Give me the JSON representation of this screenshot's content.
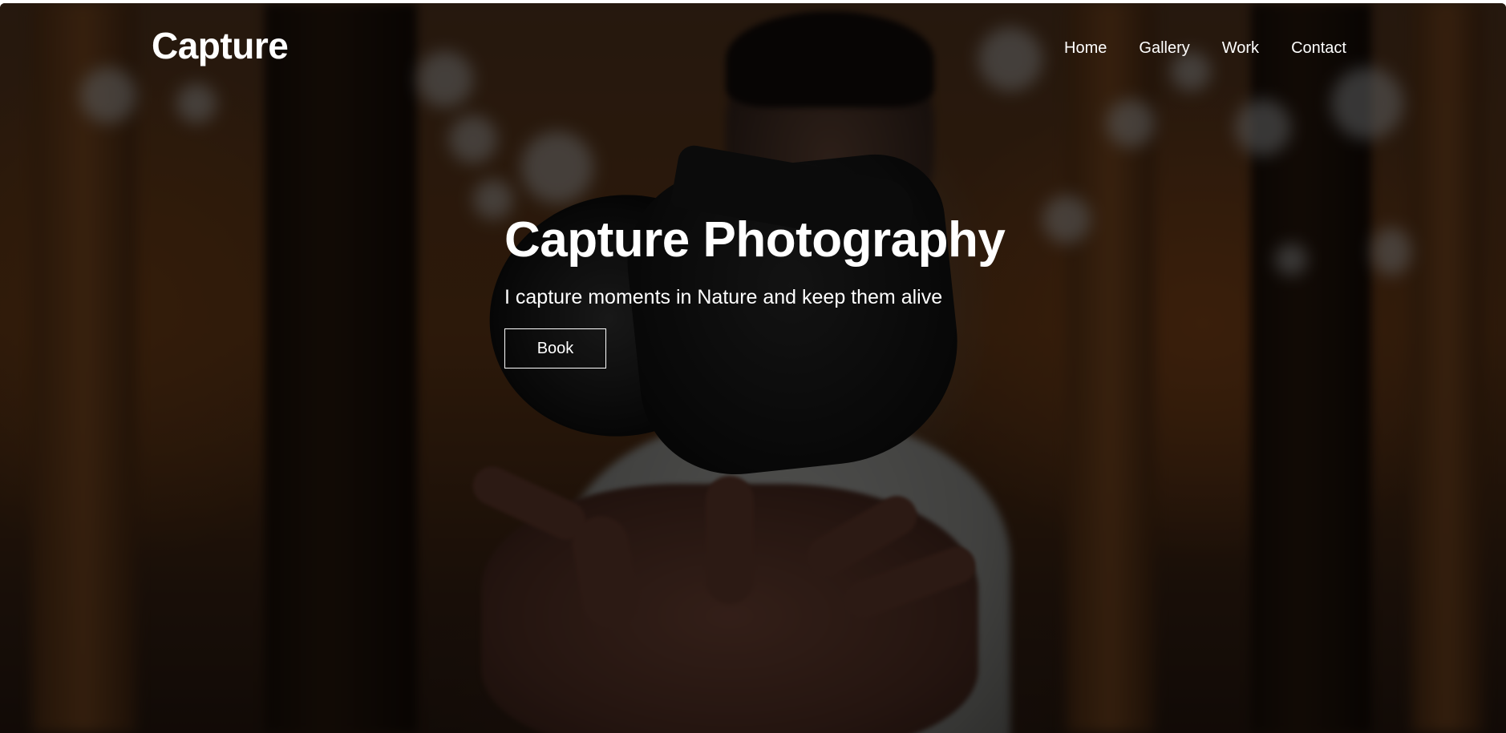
{
  "brand": {
    "logo_text": "Capture"
  },
  "nav": {
    "items": [
      {
        "label": "Home"
      },
      {
        "label": "Gallery"
      },
      {
        "label": "Work"
      },
      {
        "label": "Contact"
      }
    ]
  },
  "hero": {
    "title": "Capture Photography",
    "subtitle": "I capture moments in Nature and keep them alive",
    "cta_label": "Book",
    "background_image": "man-tossing-camera-in-forest",
    "overlay_color": "#000000"
  },
  "colors": {
    "text": "#ffffff",
    "button_border": "#ffffff"
  }
}
